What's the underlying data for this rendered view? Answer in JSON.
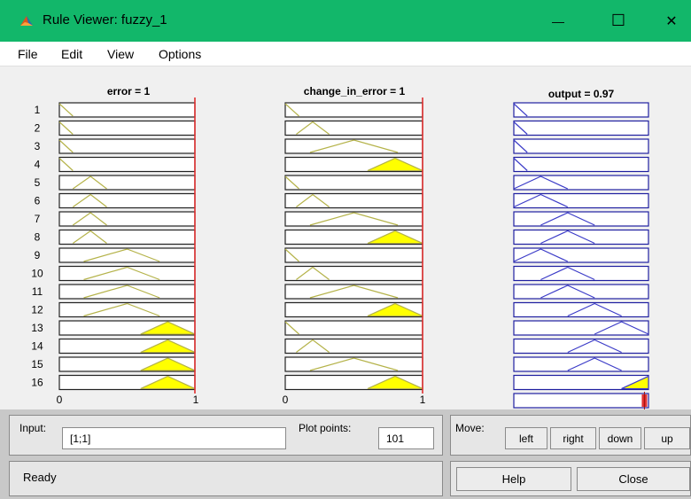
{
  "window": {
    "title": "Rule Viewer: fuzzy_1",
    "minimize_glyph": "—",
    "maximize_glyph": "☐",
    "close_glyph": "✕"
  },
  "menu": [
    "File",
    "Edit",
    "View",
    "Options"
  ],
  "viewer": {
    "columns": [
      {
        "header": "error = 1",
        "axis_min": "0",
        "axis_max": "1",
        "input_value": 1
      },
      {
        "header": "change_in_error = 1",
        "axis_min": "0",
        "axis_max": "1",
        "input_value": 1
      },
      {
        "header": "output = 0.97",
        "output_value": 0.97
      }
    ],
    "rules": [
      {
        "label": "1",
        "error_mf": [
          0,
          0,
          0.1
        ],
        "error_fire": 0,
        "change_mf": [
          0,
          0,
          0.1
        ],
        "change_fire": 0,
        "output_mf": [
          0,
          0,
          0.1
        ],
        "output_fire": 0
      },
      {
        "label": "2",
        "error_mf": [
          0,
          0,
          0.1
        ],
        "error_fire": 0,
        "change_mf": [
          0.08,
          0.2,
          0.32
        ],
        "change_fire": 0,
        "output_mf": [
          0,
          0,
          0.1
        ],
        "output_fire": 0
      },
      {
        "label": "3",
        "error_mf": [
          0,
          0,
          0.1
        ],
        "error_fire": 0,
        "change_mf": [
          0.18,
          0.5,
          0.82
        ],
        "change_fire": 0,
        "output_mf": [
          0,
          0,
          0.1
        ],
        "output_fire": 0
      },
      {
        "label": "4",
        "error_mf": [
          0,
          0,
          0.1
        ],
        "error_fire": 0,
        "change_mf": [
          0.6,
          0.8,
          1.0
        ],
        "change_fire": 1,
        "output_mf": [
          0,
          0,
          0.1
        ],
        "output_fire": 0
      },
      {
        "label": "5",
        "error_mf": [
          0.1,
          0.23,
          0.35
        ],
        "error_fire": 0,
        "change_mf": [
          0,
          0,
          0.1
        ],
        "change_fire": 0,
        "output_mf": [
          0,
          0.2,
          0.4
        ],
        "output_fire": 0
      },
      {
        "label": "6",
        "error_mf": [
          0.1,
          0.23,
          0.35
        ],
        "error_fire": 0,
        "change_mf": [
          0.08,
          0.2,
          0.32
        ],
        "change_fire": 0,
        "output_mf": [
          0,
          0.2,
          0.4
        ],
        "output_fire": 0
      },
      {
        "label": "7",
        "error_mf": [
          0.1,
          0.23,
          0.35
        ],
        "error_fire": 0,
        "change_mf": [
          0.18,
          0.5,
          0.82
        ],
        "change_fire": 0,
        "output_mf": [
          0.2,
          0.4,
          0.6
        ],
        "output_fire": 0
      },
      {
        "label": "8",
        "error_mf": [
          0.1,
          0.23,
          0.35
        ],
        "error_fire": 0,
        "change_mf": [
          0.6,
          0.8,
          1.0
        ],
        "change_fire": 1,
        "output_mf": [
          0.2,
          0.4,
          0.6
        ],
        "output_fire": 0
      },
      {
        "label": "9",
        "error_mf": [
          0.18,
          0.5,
          0.74
        ],
        "error_fire": 0,
        "change_mf": [
          0,
          0,
          0.1
        ],
        "change_fire": 0,
        "output_mf": [
          0,
          0.2,
          0.4
        ],
        "output_fire": 0
      },
      {
        "label": "10",
        "error_mf": [
          0.18,
          0.5,
          0.74
        ],
        "error_fire": 0,
        "change_mf": [
          0.08,
          0.2,
          0.32
        ],
        "change_fire": 0,
        "output_mf": [
          0.2,
          0.4,
          0.6
        ],
        "output_fire": 0
      },
      {
        "label": "11",
        "error_mf": [
          0.18,
          0.5,
          0.74
        ],
        "error_fire": 0,
        "change_mf": [
          0.18,
          0.5,
          0.82
        ],
        "change_fire": 0,
        "output_mf": [
          0.2,
          0.4,
          0.6
        ],
        "output_fire": 0
      },
      {
        "label": "12",
        "error_mf": [
          0.18,
          0.5,
          0.74
        ],
        "error_fire": 0,
        "change_mf": [
          0.6,
          0.8,
          1.0
        ],
        "change_fire": 1,
        "output_mf": [
          0.4,
          0.6,
          0.8
        ],
        "output_fire": 0
      },
      {
        "label": "13",
        "error_mf": [
          0.6,
          0.8,
          1.0
        ],
        "error_fire": 1,
        "change_mf": [
          0,
          0,
          0.1
        ],
        "change_fire": 0,
        "output_mf": [
          0.6,
          0.8,
          1.0
        ],
        "output_fire": 0
      },
      {
        "label": "14",
        "error_mf": [
          0.6,
          0.8,
          1.0
        ],
        "error_fire": 1,
        "change_mf": [
          0.08,
          0.2,
          0.32
        ],
        "change_fire": 0,
        "output_mf": [
          0.4,
          0.6,
          0.8
        ],
        "output_fire": 0
      },
      {
        "label": "15",
        "error_mf": [
          0.6,
          0.8,
          1.0
        ],
        "error_fire": 1,
        "change_mf": [
          0.18,
          0.5,
          0.82
        ],
        "change_fire": 0,
        "output_mf": [
          0.4,
          0.6,
          0.8
        ],
        "output_fire": 0
      },
      {
        "label": "16",
        "error_mf": [
          0.6,
          0.8,
          1.0
        ],
        "error_fire": 1,
        "change_mf": [
          0.6,
          0.8,
          1.0
        ],
        "change_fire": 1,
        "output_mf": [
          0.8,
          1.0,
          1.0
        ],
        "output_fire": 1
      }
    ],
    "colors": {
      "input_mf_line": "#b5b34a",
      "fill": "#ffff00",
      "output_mf_line": "#3c3cc8",
      "output_box": "#1f1fa0",
      "indicator": "#e03030",
      "box_border": "#222222"
    }
  },
  "controls": {
    "input_label": "Input:",
    "input_value": "[1;1]",
    "plot_points_label": "Plot points:",
    "plot_points_value": "101",
    "move_label": "Move:",
    "move_buttons": [
      "left",
      "right",
      "down",
      "up"
    ],
    "status": "Ready",
    "help_label": "Help",
    "close_label": "Close"
  }
}
